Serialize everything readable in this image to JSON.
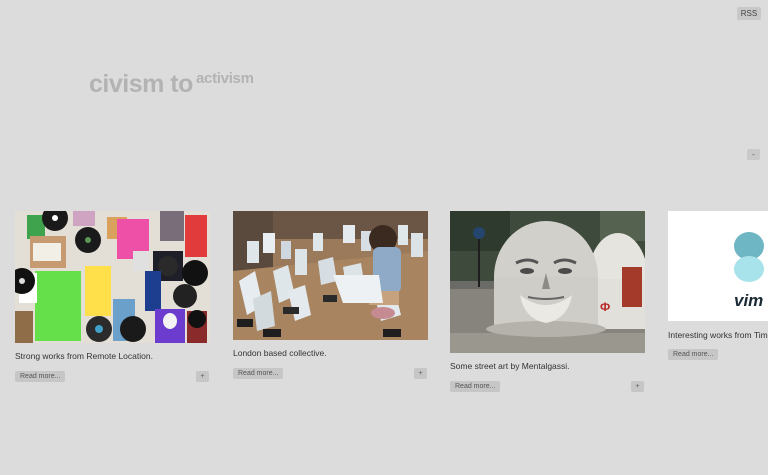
{
  "header": {
    "rss_label": "RSS",
    "logo_main": "civism to",
    "logo_sup": "activism",
    "collapse_label": "-"
  },
  "cards": [
    {
      "caption": "Strong works from Remote Location.",
      "read_more": "Read more...",
      "plus": "+"
    },
    {
      "caption": "London based collective.",
      "read_more": "Read more...",
      "plus": "+"
    },
    {
      "caption": "Some street art by Mentalgassi.",
      "read_more": "Read more...",
      "plus": "+"
    },
    {
      "caption": "Interesting works from Tim",
      "read_more": "Read more...",
      "thumb_text": "vim"
    }
  ],
  "colors": {
    "background": "#dcdcdc",
    "button": "#c6c6c6",
    "logo_text": "#b3b3b3"
  }
}
